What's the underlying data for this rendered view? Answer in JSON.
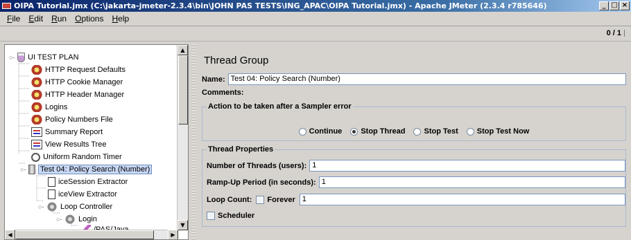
{
  "window": {
    "title": "OIPA Tutorial.jmx (C:\\jakarta-jmeter-2.3.4\\bin\\JOHN PAS TESTS\\ING_APAC\\OIPA Tutorial.jmx) - Apache JMeter (2.3.4 r785646)",
    "buttons": {
      "minimize": "_",
      "maximize": "□",
      "close": "×"
    }
  },
  "menu": [
    {
      "label": "File",
      "mnemonic": "F",
      "rest": "ile"
    },
    {
      "label": "Edit",
      "mnemonic": "E",
      "rest": "dit"
    },
    {
      "label": "Run",
      "mnemonic": "R",
      "rest": "un"
    },
    {
      "label": "Options",
      "mnemonic": "O",
      "rest": "ptions"
    },
    {
      "label": "Help",
      "mnemonic": "H",
      "rest": "elp"
    }
  ],
  "toolbar": {
    "counter": "0 / 1"
  },
  "tree": {
    "items": [
      {
        "label": "UI TEST PLAN",
        "icon": "flask-icon"
      },
      {
        "label": "HTTP Request Defaults",
        "icon": "config-element-icon"
      },
      {
        "label": "HTTP Cookie Manager",
        "icon": "config-element-icon"
      },
      {
        "label": "HTTP Header Manager",
        "icon": "config-element-icon"
      },
      {
        "label": "Logins",
        "icon": "config-element-icon"
      },
      {
        "label": "Policy Numbers File",
        "icon": "config-element-icon"
      },
      {
        "label": "Summary Report",
        "icon": "report-icon"
      },
      {
        "label": "View Results Tree",
        "icon": "report-icon"
      },
      {
        "label": "Uniform Random Timer",
        "icon": "timer-icon"
      },
      {
        "label": "Test 04: Policy Search (Number)",
        "icon": "thread-group-icon",
        "selected": true
      },
      {
        "label": "iceSession Extractor",
        "icon": "extractor-icon"
      },
      {
        "label": "iceView Extractor",
        "icon": "extractor-icon"
      },
      {
        "label": "Loop Controller",
        "icon": "loop-controller-icon"
      },
      {
        "label": "Login",
        "icon": "loop-controller-icon"
      },
      {
        "label": "/PAS/Java",
        "icon": "sampler-icon"
      }
    ]
  },
  "thread_group": {
    "title": "Thread Group",
    "name_label": "Name:",
    "name_value": "Test 04: Policy Search (Number)",
    "comments_label": "Comments:",
    "sampler_error": {
      "legend": "Action to be taken after a Sampler error",
      "options": [
        {
          "label": "Continue",
          "selected": false
        },
        {
          "label": "Stop Thread",
          "selected": true
        },
        {
          "label": "Stop Test",
          "selected": false
        },
        {
          "label": "Stop Test Now",
          "selected": false
        }
      ]
    },
    "properties": {
      "legend": "Thread Properties",
      "threads_label": "Number of Threads (users):",
      "threads_value": "1",
      "rampup_label": "Ramp-Up Period (in seconds):",
      "rampup_value": "1",
      "loop_label": "Loop Count:",
      "forever_label": "Forever",
      "forever_checked": false,
      "loop_value": "1"
    },
    "scheduler_label": "Scheduler",
    "scheduler_checked": false
  },
  "colors": {
    "title_bar_start": "#0a246a",
    "title_bar_end": "#a6caf0",
    "panel_bg": "#d6d3ce",
    "selection": "#c8d8f4",
    "input_border": "#7a96bf"
  }
}
